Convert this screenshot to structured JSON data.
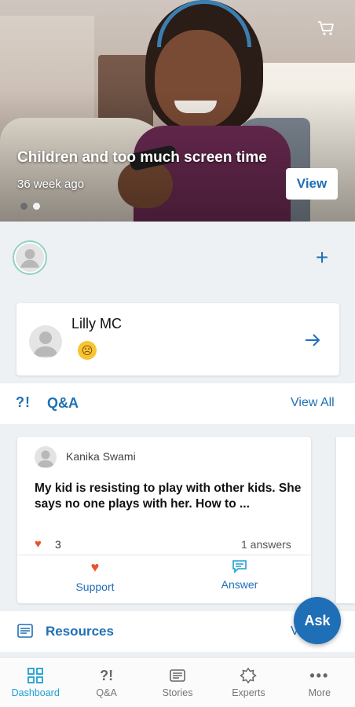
{
  "hero": {
    "title": "Children and too much screen time",
    "subtitle": "36 week ago",
    "view_label": "View",
    "page_dots": 2,
    "active_dot": 1
  },
  "feed_card": {
    "name": "Lilly MC"
  },
  "qa_section": {
    "icon_text": "?!",
    "title": "Q&A",
    "view_all": "View All",
    "question": {
      "author": "Kanika Swami",
      "text": "My kid is resisting to play with other kids. She says no one plays with her. How to ...",
      "likes": "3",
      "answers": "1 answers",
      "support_label": "Support",
      "answer_label": "Answer"
    }
  },
  "resources_section": {
    "title": "Resources",
    "view_all": "View All"
  },
  "ask_button": "Ask",
  "bottom_nav": [
    {
      "label": "Dashboard",
      "icon": "dashboard-icon",
      "active": true
    },
    {
      "label": "Q&A",
      "icon": "qa-icon",
      "active": false
    },
    {
      "label": "Stories",
      "icon": "stories-icon",
      "active": false
    },
    {
      "label": "Experts",
      "icon": "experts-icon",
      "active": false
    },
    {
      "label": "More",
      "icon": "more-icon",
      "active": false
    }
  ],
  "colors": {
    "accent": "#1f6fb6",
    "active_nav": "#1f9fd0",
    "heart": "#e8532f",
    "background": "#eef1f3"
  }
}
